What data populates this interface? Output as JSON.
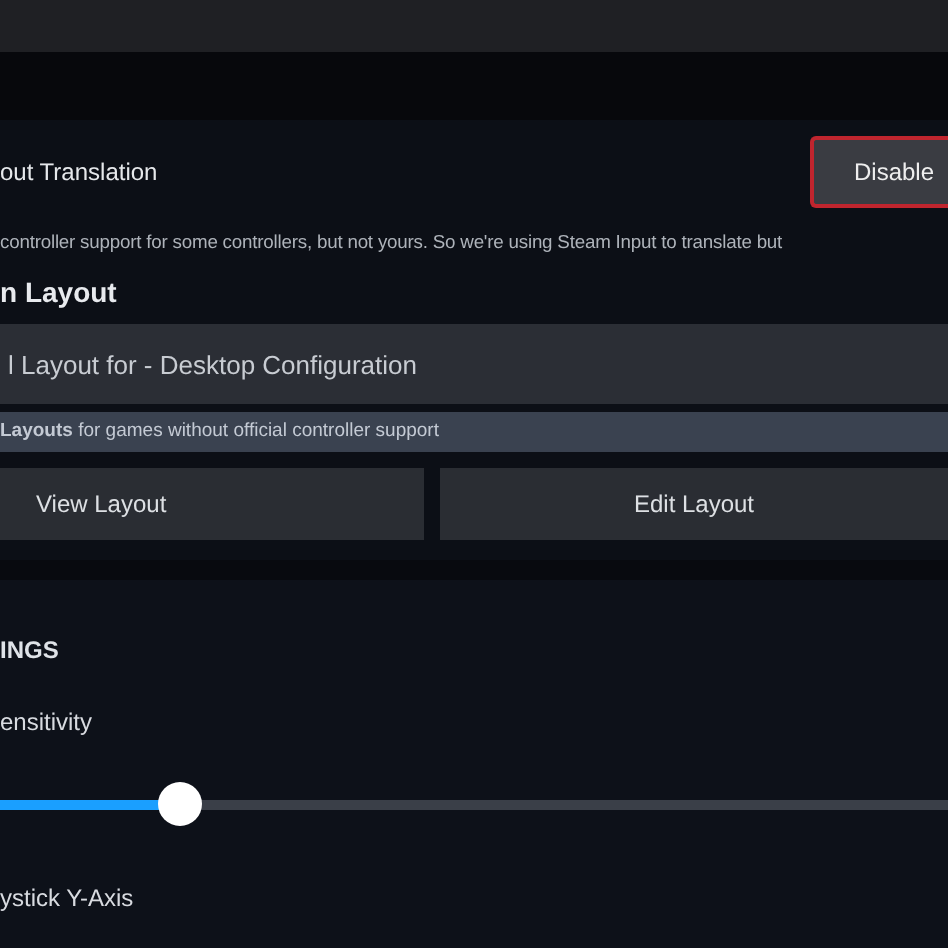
{
  "translation": {
    "title": "out Translation",
    "button": "Disable",
    "button_focused": true,
    "description": "controller support for some controllers, but not yours. So we're using Steam Input to translate but"
  },
  "layout": {
    "heading": "n Layout",
    "current": "l Layout for - Desktop Configuration",
    "note": "**Layouts** for games without official controller support",
    "buttons": [
      "View Layout",
      "Edit Layout"
    ]
  },
  "settings": {
    "heading": "INGS",
    "rows": [
      {
        "kind": "slider",
        "label": "ensitivity",
        "level": 0.19
      },
      {
        "kind": "label",
        "label": "ystick Y-Axis"
      }
    ]
  }
}
